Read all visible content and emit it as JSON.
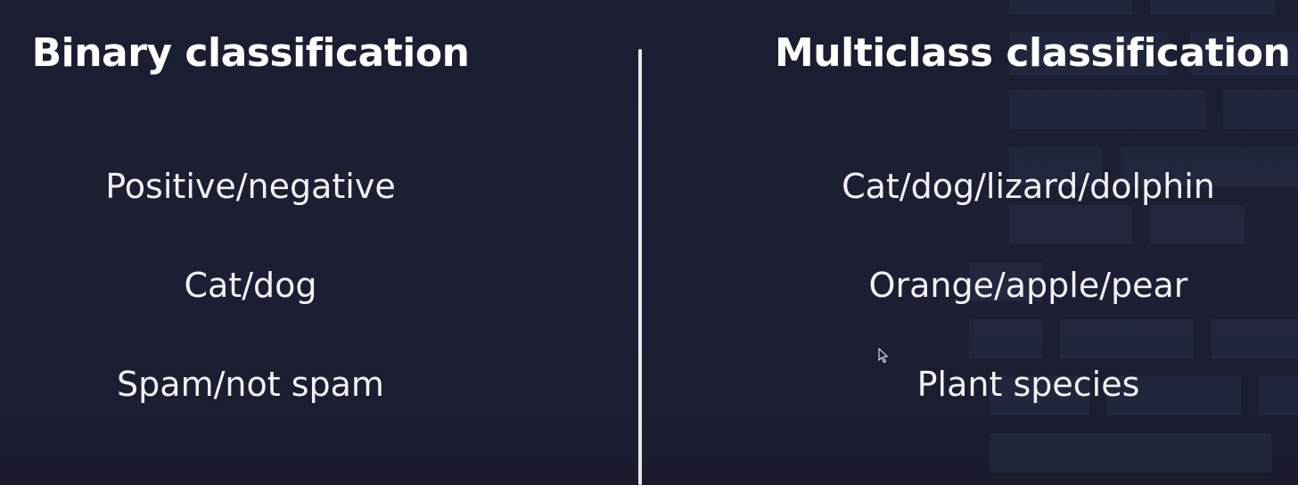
{
  "binary": {
    "title": "Binary classification",
    "items": [
      "Positive/negative",
      "Cat/dog",
      "Spam/not spam"
    ]
  },
  "multiclass": {
    "title": "Multiclass classification",
    "items": [
      "Cat/dog/lizard/dolphin",
      "Orange/apple/pear",
      "Plant species"
    ]
  },
  "colors": {
    "background": "#1c1e33",
    "text": "#ffffff",
    "divider": "#e6e6ea",
    "block": "#262a40"
  },
  "icons": {
    "cursor": "mouse-pointer-icon"
  }
}
